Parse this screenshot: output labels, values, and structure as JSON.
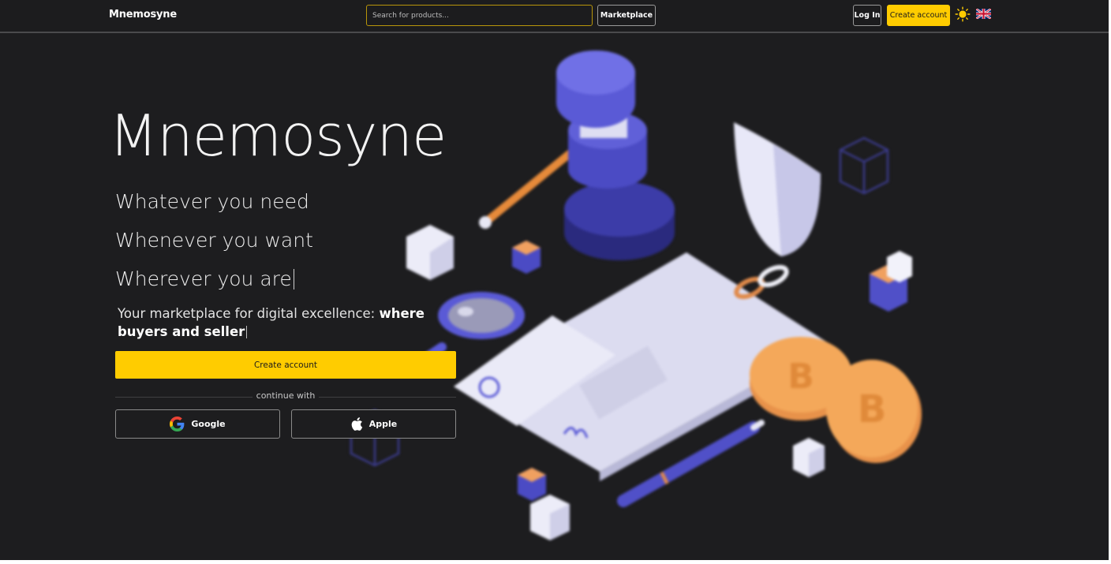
{
  "header": {
    "logo": "Mnemosyne",
    "search_placeholder": "Search for products...",
    "marketplace_label": "Marketplace",
    "login_label": "Log In",
    "create_account_label": "Create account",
    "theme_icon": "sun-icon",
    "language_icon": "uk-flag-icon"
  },
  "hero": {
    "title": "Mnemosyne",
    "taglines": [
      "Whatever you need",
      "Whenever you want",
      "Wherever you are"
    ],
    "description_plain": "Your marketplace for digital excellence: ",
    "description_bold": "where buyers and seller",
    "create_account_label": "Create account",
    "continue_with": "continue with",
    "google_label": "Google",
    "apple_label": "Apple",
    "illustration": "isometric-marketplace-illustration"
  },
  "colors": {
    "background": "#1d1d1f",
    "accent": "#ffcc00",
    "illustration_primary": "#5a5ad6"
  }
}
